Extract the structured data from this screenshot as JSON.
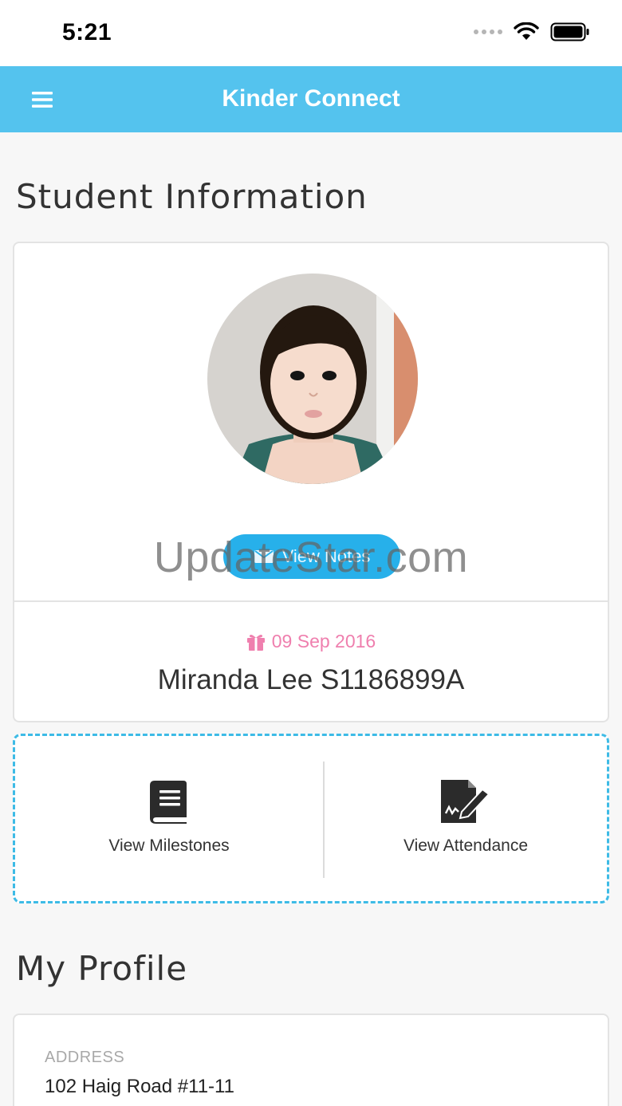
{
  "status_bar": {
    "time": "5:21"
  },
  "app": {
    "title": "Kinder Connect",
    "accent_color": "#54c3ee"
  },
  "sections": {
    "student_info_title": "Student Information",
    "profile_title": "My Profile"
  },
  "student": {
    "notes_button_label": "View Notes",
    "dob": "09 Sep 2016",
    "name": "Miranda Lee S1186899A"
  },
  "watermark": "UpdateStar.com",
  "actions": [
    {
      "label": "View Milestones",
      "icon": "book-icon"
    },
    {
      "label": "View Attendance",
      "icon": "signature-edit-icon"
    }
  ],
  "profile": {
    "address_label": "ADDRESS",
    "address_value": "102 Haig Road #11-11"
  },
  "icons": {
    "menu": "hamburger-menu-icon",
    "gift": "gift-icon",
    "envelope": "envelope-icon",
    "wifi": "wifi-icon",
    "battery": "battery-icon"
  }
}
